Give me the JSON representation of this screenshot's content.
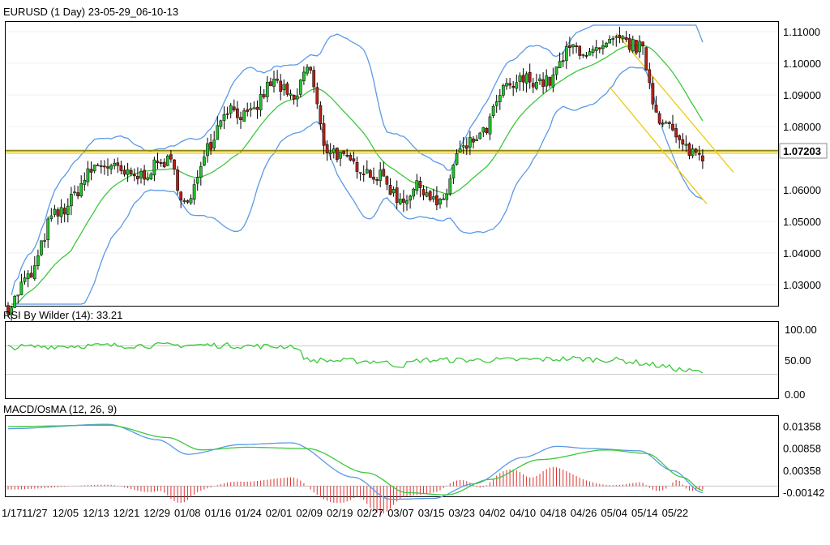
{
  "panels": {
    "price_title": "EURUSD (1 Day) 23-05-29_06-10-13",
    "rsi_title": "RSI By Wilder (14): 33.21",
    "macd_title": "MACD/OsMA (12, 26, 9)"
  },
  "current_price_label": "1.07203",
  "colors": {
    "bull": "#22c32a",
    "bear": "#b02318",
    "bollinger": "#5a9ae8",
    "ma": "#3cc83c",
    "support": "#8a8a10",
    "channel": "#f0c814",
    "rsi": "#3cc83c",
    "macd": "#5a9ae8",
    "signal": "#3cc83c",
    "osma": "#e03030"
  },
  "chart_data": [
    {
      "type": "candlestick",
      "title": "EURUSD (1 Day) 23-05-29_06-10-13",
      "x_tick_labels": [
        "1/17",
        "11/27",
        "12/05",
        "12/13",
        "12/21",
        "12/29",
        "01/08",
        "01/16",
        "01/24",
        "02/01",
        "02/09",
        "02/19",
        "02/27",
        "03/07",
        "03/15",
        "03/23",
        "04/02",
        "04/10",
        "04/18",
        "04/26",
        "05/04",
        "05/14",
        "05/22"
      ],
      "y_tick_labels": [
        "1.11000",
        "1.10000",
        "1.09000",
        "1.08000",
        "1.07000",
        "1.06000",
        "1.05000",
        "1.04000",
        "1.03000"
      ],
      "ylim": [
        1.022,
        1.112
      ],
      "last_price": 1.07203,
      "horizontal_line": 1.072,
      "overlays": [
        "Bollinger Bands",
        "Moving Average",
        "Descending channel"
      ]
    },
    {
      "type": "line",
      "title": "RSI By Wilder (14): 33.21",
      "y_tick_labels": [
        "100.00",
        "50.00",
        "0.00"
      ],
      "ylim": [
        0,
        100
      ],
      "reference_lines": [
        70,
        30
      ],
      "last_value": 33.21
    },
    {
      "type": "line",
      "title": "MACD/OsMA (12, 26, 9)",
      "y_tick_labels": [
        "0.01358",
        "0.00858",
        "0.00358",
        "-0.00142"
      ],
      "ylim": [
        -0.0037,
        0.0155
      ],
      "series": [
        {
          "name": "MACD"
        },
        {
          "name": "Signal"
        },
        {
          "name": "OsMA"
        }
      ]
    }
  ]
}
